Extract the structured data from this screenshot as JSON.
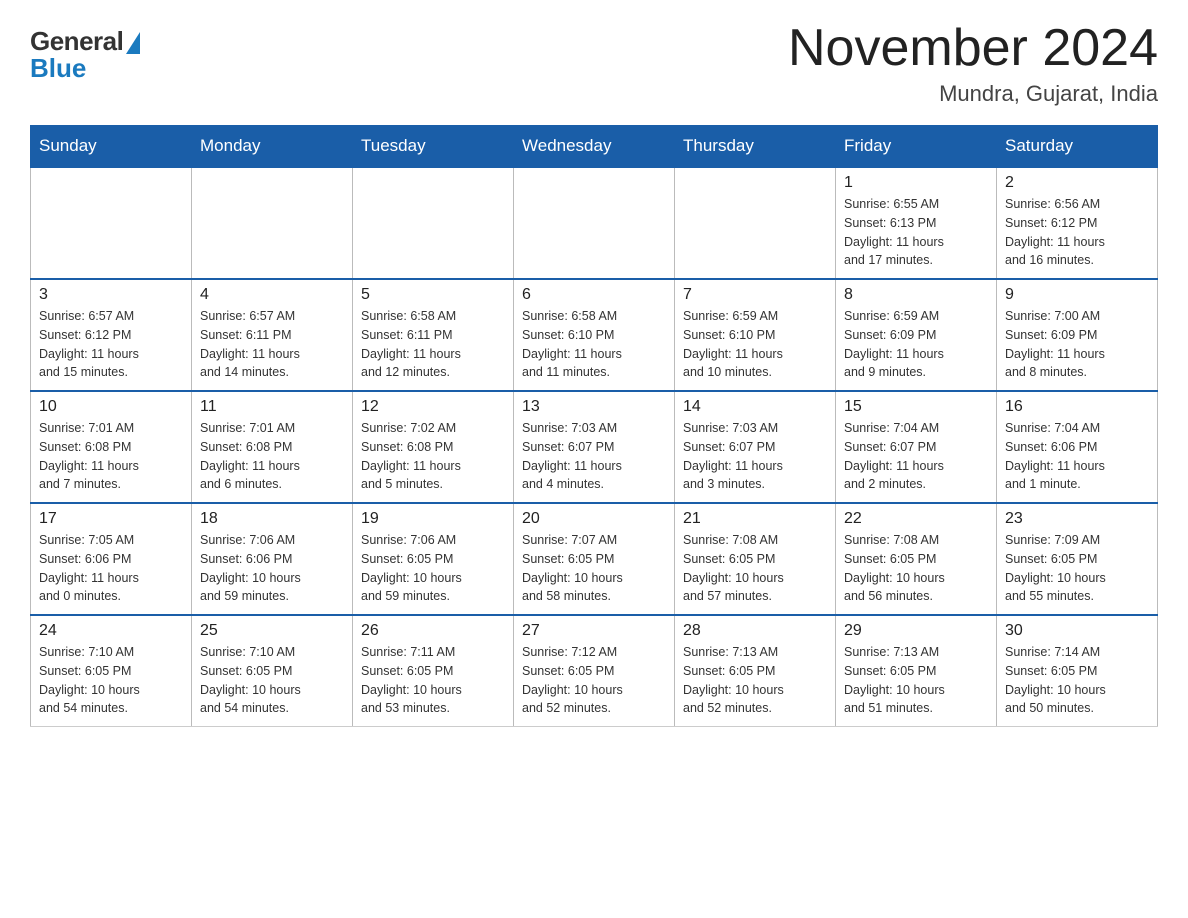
{
  "logo": {
    "general": "General",
    "blue": "Blue"
  },
  "header": {
    "month": "November 2024",
    "location": "Mundra, Gujarat, India"
  },
  "weekdays": [
    "Sunday",
    "Monday",
    "Tuesday",
    "Wednesday",
    "Thursday",
    "Friday",
    "Saturday"
  ],
  "weeks": [
    [
      {
        "day": "",
        "info": ""
      },
      {
        "day": "",
        "info": ""
      },
      {
        "day": "",
        "info": ""
      },
      {
        "day": "",
        "info": ""
      },
      {
        "day": "",
        "info": ""
      },
      {
        "day": "1",
        "info": "Sunrise: 6:55 AM\nSunset: 6:13 PM\nDaylight: 11 hours\nand 17 minutes."
      },
      {
        "day": "2",
        "info": "Sunrise: 6:56 AM\nSunset: 6:12 PM\nDaylight: 11 hours\nand 16 minutes."
      }
    ],
    [
      {
        "day": "3",
        "info": "Sunrise: 6:57 AM\nSunset: 6:12 PM\nDaylight: 11 hours\nand 15 minutes."
      },
      {
        "day": "4",
        "info": "Sunrise: 6:57 AM\nSunset: 6:11 PM\nDaylight: 11 hours\nand 14 minutes."
      },
      {
        "day": "5",
        "info": "Sunrise: 6:58 AM\nSunset: 6:11 PM\nDaylight: 11 hours\nand 12 minutes."
      },
      {
        "day": "6",
        "info": "Sunrise: 6:58 AM\nSunset: 6:10 PM\nDaylight: 11 hours\nand 11 minutes."
      },
      {
        "day": "7",
        "info": "Sunrise: 6:59 AM\nSunset: 6:10 PM\nDaylight: 11 hours\nand 10 minutes."
      },
      {
        "day": "8",
        "info": "Sunrise: 6:59 AM\nSunset: 6:09 PM\nDaylight: 11 hours\nand 9 minutes."
      },
      {
        "day": "9",
        "info": "Sunrise: 7:00 AM\nSunset: 6:09 PM\nDaylight: 11 hours\nand 8 minutes."
      }
    ],
    [
      {
        "day": "10",
        "info": "Sunrise: 7:01 AM\nSunset: 6:08 PM\nDaylight: 11 hours\nand 7 minutes."
      },
      {
        "day": "11",
        "info": "Sunrise: 7:01 AM\nSunset: 6:08 PM\nDaylight: 11 hours\nand 6 minutes."
      },
      {
        "day": "12",
        "info": "Sunrise: 7:02 AM\nSunset: 6:08 PM\nDaylight: 11 hours\nand 5 minutes."
      },
      {
        "day": "13",
        "info": "Sunrise: 7:03 AM\nSunset: 6:07 PM\nDaylight: 11 hours\nand 4 minutes."
      },
      {
        "day": "14",
        "info": "Sunrise: 7:03 AM\nSunset: 6:07 PM\nDaylight: 11 hours\nand 3 minutes."
      },
      {
        "day": "15",
        "info": "Sunrise: 7:04 AM\nSunset: 6:07 PM\nDaylight: 11 hours\nand 2 minutes."
      },
      {
        "day": "16",
        "info": "Sunrise: 7:04 AM\nSunset: 6:06 PM\nDaylight: 11 hours\nand 1 minute."
      }
    ],
    [
      {
        "day": "17",
        "info": "Sunrise: 7:05 AM\nSunset: 6:06 PM\nDaylight: 11 hours\nand 0 minutes."
      },
      {
        "day": "18",
        "info": "Sunrise: 7:06 AM\nSunset: 6:06 PM\nDaylight: 10 hours\nand 59 minutes."
      },
      {
        "day": "19",
        "info": "Sunrise: 7:06 AM\nSunset: 6:05 PM\nDaylight: 10 hours\nand 59 minutes."
      },
      {
        "day": "20",
        "info": "Sunrise: 7:07 AM\nSunset: 6:05 PM\nDaylight: 10 hours\nand 58 minutes."
      },
      {
        "day": "21",
        "info": "Sunrise: 7:08 AM\nSunset: 6:05 PM\nDaylight: 10 hours\nand 57 minutes."
      },
      {
        "day": "22",
        "info": "Sunrise: 7:08 AM\nSunset: 6:05 PM\nDaylight: 10 hours\nand 56 minutes."
      },
      {
        "day": "23",
        "info": "Sunrise: 7:09 AM\nSunset: 6:05 PM\nDaylight: 10 hours\nand 55 minutes."
      }
    ],
    [
      {
        "day": "24",
        "info": "Sunrise: 7:10 AM\nSunset: 6:05 PM\nDaylight: 10 hours\nand 54 minutes."
      },
      {
        "day": "25",
        "info": "Sunrise: 7:10 AM\nSunset: 6:05 PM\nDaylight: 10 hours\nand 54 minutes."
      },
      {
        "day": "26",
        "info": "Sunrise: 7:11 AM\nSunset: 6:05 PM\nDaylight: 10 hours\nand 53 minutes."
      },
      {
        "day": "27",
        "info": "Sunrise: 7:12 AM\nSunset: 6:05 PM\nDaylight: 10 hours\nand 52 minutes."
      },
      {
        "day": "28",
        "info": "Sunrise: 7:13 AM\nSunset: 6:05 PM\nDaylight: 10 hours\nand 52 minutes."
      },
      {
        "day": "29",
        "info": "Sunrise: 7:13 AM\nSunset: 6:05 PM\nDaylight: 10 hours\nand 51 minutes."
      },
      {
        "day": "30",
        "info": "Sunrise: 7:14 AM\nSunset: 6:05 PM\nDaylight: 10 hours\nand 50 minutes."
      }
    ]
  ]
}
